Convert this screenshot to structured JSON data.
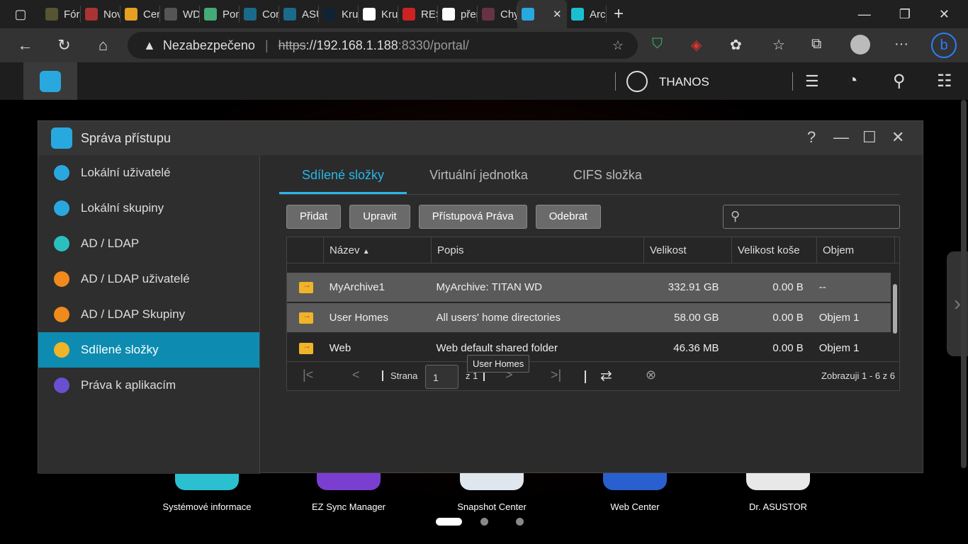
{
  "browser": {
    "tabs": [
      "Fóru",
      "Novi",
      "Cent",
      "WD",
      "Pom",
      "Com",
      "ASU",
      "Kruh",
      "Kruh",
      "RESI",
      "přen",
      "Chyt",
      "",
      "Arch"
    ],
    "security": "Nezabezpečeno",
    "url_scheme": "https",
    "url_host": "://192.168.1.188",
    "url_rest": ":8330/portal/"
  },
  "nas": {
    "user": "THANOS"
  },
  "window": {
    "title": "Správa přístupu",
    "help": "?"
  },
  "sidebar": [
    {
      "label": "Lokální uživatelé",
      "color": "#29a8e0"
    },
    {
      "label": "Lokální skupiny",
      "color": "#29a8e0"
    },
    {
      "label": "AD / LDAP",
      "color": "#2bc0c0"
    },
    {
      "label": "AD / LDAP uživatelé",
      "color": "#f08a1c"
    },
    {
      "label": "AD / LDAP Skupiny",
      "color": "#f08a1c"
    },
    {
      "label": "Sdílené složky",
      "color": "#f0b429"
    },
    {
      "label": "Práva k aplikacím",
      "color": "#6a4fd0"
    }
  ],
  "tabs": [
    "Sdílené složky",
    "Virtuální jednotka",
    "CIFS složka"
  ],
  "toolbar": [
    "Přidat",
    "Upravit",
    "Přístupová Práva",
    "Odebrat"
  ],
  "table": {
    "headers": [
      "Název",
      "Popis",
      "Velikost",
      "Velikost koše",
      "Objem"
    ],
    "rows": [
      [
        "MyArchive1",
        "MyArchive: TITAN WD",
        "332.91 GB",
        "0.00 B",
        "--"
      ],
      [
        "User Homes",
        "All users' home directories",
        "58.00 GB",
        "0.00 B",
        "Objem 1"
      ],
      [
        "Web",
        "Web default shared folder",
        "46.36 MB",
        "0.00 B",
        "Objem 1"
      ]
    ],
    "tooltip": "User Homes"
  },
  "pager": {
    "page_label": "Strana",
    "page": "1",
    "of": "z 1",
    "status": "Zobrazuji 1 - 6 z 6"
  },
  "dock": [
    {
      "label": "Systémové informace",
      "color": "#2bc0d0"
    },
    {
      "label": "EZ Sync Manager",
      "color": "#7a3fd0"
    },
    {
      "label": "Snapshot Center",
      "color": "#dfe6ee"
    },
    {
      "label": "Web Center",
      "color": "#2a5fd0"
    },
    {
      "label": "Dr. ASUSTOR",
      "color": "#e8e8e8"
    }
  ]
}
